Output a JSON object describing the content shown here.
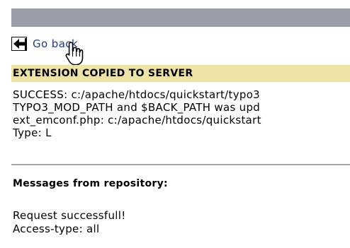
{
  "header_bar": {
    "color": "#999ea9"
  },
  "back": {
    "icon": "arrow-left-icon",
    "label": "Go back"
  },
  "extension": {
    "heading": "EXTENSION COPIED TO SERVER",
    "heading_bg": "#ede2a8",
    "lines": [
      "SUCCESS: c:/apache/htdocs/quickstart/typo3",
      "TYPO3_MOD_PATH and $BACK_PATH was upd",
      "ext_emconf.php: c:/apache/htdocs/quickstart",
      "Type: L"
    ]
  },
  "repository": {
    "heading": "Messages from repository:",
    "lines": [
      "Request successfull!",
      "Access-type: all"
    ]
  },
  "cursor": {
    "icon": "hand-pointer-icon"
  }
}
